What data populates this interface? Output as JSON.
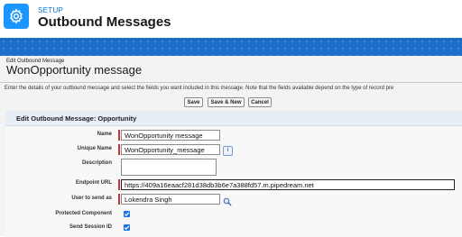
{
  "header": {
    "section": "SETUP",
    "title": "Outbound Messages"
  },
  "page": {
    "breadcrumb": "Edit Outbound Message",
    "title": "WonOpportunity message",
    "description": "Enter the details of your outbound message and select the fields you want included in this message. Note that the fields available depend on the type of record pre"
  },
  "buttons": {
    "save": "Save",
    "save_new": "Save & New",
    "cancel": "Cancel"
  },
  "section": {
    "title": "Edit Outbound Message: Opportunity"
  },
  "fields": {
    "name": {
      "label": "Name",
      "value": "WonOpportunity message"
    },
    "unique_name": {
      "label": "Unique Name",
      "value": "WonOpportunity_message"
    },
    "description": {
      "label": "Description",
      "value": ""
    },
    "endpoint_url": {
      "label": "Endpoint URL",
      "value": "https://409a16eaacf281d38db3b6e7a388fd57.m.pipedream.net"
    },
    "user_to_send_as": {
      "label": "User to send as",
      "value": "Lokendra Singh"
    },
    "protected_component": {
      "label": "Protected Component",
      "checked": true
    },
    "send_session_id": {
      "label": "Send Session ID",
      "checked": true
    }
  },
  "icons": {
    "header": "gear-icon",
    "unique_name_help": "info-icon",
    "user_lookup": "lookup-icon"
  },
  "colors": {
    "brand_blue": "#1d6ec8",
    "tile_blue": "#1b96ff",
    "required_red": "#c23934",
    "checkbox_blue": "#1a73e8"
  }
}
